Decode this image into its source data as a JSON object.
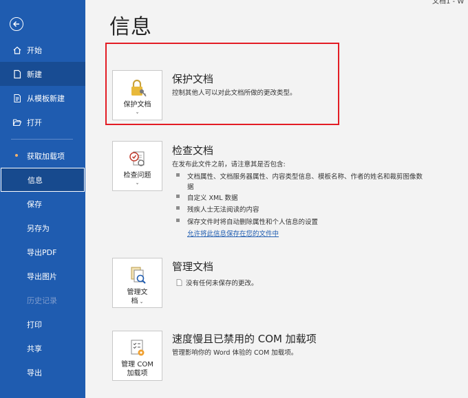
{
  "corner": {
    "text": "文档1 - W"
  },
  "sidebar": {
    "items": [
      {
        "label": "开始",
        "icon": "home-icon"
      },
      {
        "label": "新建",
        "icon": "new-document-icon"
      },
      {
        "label": "从模板新建",
        "icon": "template-icon"
      },
      {
        "label": "打开",
        "icon": "folder-open-icon"
      },
      {
        "label": "获取加载项"
      },
      {
        "label": "信息"
      },
      {
        "label": "保存"
      },
      {
        "label": "另存为"
      },
      {
        "label": "导出PDF"
      },
      {
        "label": "导出图片"
      },
      {
        "label": "历史记录"
      },
      {
        "label": "打印"
      },
      {
        "label": "共享"
      },
      {
        "label": "导出"
      }
    ]
  },
  "page": {
    "title": "信息"
  },
  "protect": {
    "tile_label": "保护文档",
    "title": "保护文档",
    "desc": "控制其他人可以对此文档所做的更改类型。"
  },
  "inspect": {
    "tile_label": "检查问题",
    "title": "检查文档",
    "desc": "在发布此文件之前，请注意其是否包含:",
    "bullets": [
      "文档属性、文档服务器属性、内容类型信息、模板名称、作者的姓名和裁剪图像数",
      "据",
      "自定义 XML 数据",
      "残疾人士无法阅读的内容",
      "保存文件时将自动删除属性和个人信息的设置"
    ],
    "link": "允许将此信息保存在您的文件中"
  },
  "manage": {
    "tile_label_1": "管理文",
    "tile_label_2": "档",
    "title": "管理文档",
    "desc": "没有任何未保存的更改。"
  },
  "com": {
    "tile_label_1": "管理 COM",
    "tile_label_2": "加载项",
    "title": "速度慢且已禁用的 COM 加载项",
    "desc": "管理影响你的 Word 体验的 COM 加载项。"
  },
  "colors": {
    "sidebar": "#1f5cb0",
    "highlight": "#e31b23",
    "link": "#1f5cb0"
  }
}
